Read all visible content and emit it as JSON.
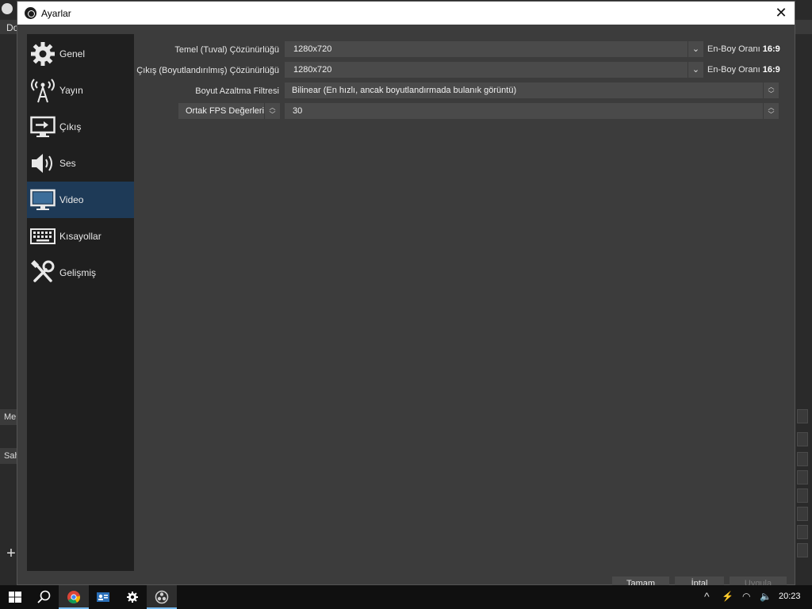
{
  "background": {
    "menu_text": "Do",
    "dock_scenes_title": "Sah",
    "dock_media_title": "Me"
  },
  "dialog": {
    "title": "Ayarlar",
    "close_icon": "close-icon"
  },
  "sidebar": {
    "items": [
      {
        "label": "Genel",
        "icon": "gear-icon"
      },
      {
        "label": "Yayın",
        "icon": "broadcast-antenna-icon"
      },
      {
        "label": "Çıkış",
        "icon": "output-monitor-icon"
      },
      {
        "label": "Ses",
        "icon": "speaker-icon"
      },
      {
        "label": "Video",
        "icon": "monitor-icon",
        "active": true
      },
      {
        "label": "Kısayollar",
        "icon": "keyboard-icon"
      },
      {
        "label": "Gelişmiş",
        "icon": "tools-icon"
      }
    ]
  },
  "video": {
    "base_resolution_label": "Temel (Tuval) Çözünürlüğü",
    "base_resolution_value": "1280x720",
    "base_aspect_label": "En-Boy Oranı",
    "base_aspect_value": "16:9",
    "output_resolution_label": "Çıkış (Boyutlandırılmış) Çözünürlüğü",
    "output_resolution_value": "1280x720",
    "output_aspect_label": "En-Boy Oranı",
    "output_aspect_value": "16:9",
    "downscale_filter_label": "Boyut Azaltma Filtresi",
    "downscale_filter_value": "Bilinear (En hızlı, ancak boyutlandırmada bulanık görüntü)",
    "fps_type_value": "Ortak FPS Değerleri",
    "fps_value": "30"
  },
  "buttons": {
    "ok": "Tamam",
    "cancel": "İptal",
    "apply": "Uygula"
  },
  "taskbar": {
    "clock": "20:23",
    "apps": [
      "start-icon",
      "search-icon",
      "chrome-icon",
      "contact-card-icon",
      "settings-icon",
      "obs-icon"
    ]
  }
}
